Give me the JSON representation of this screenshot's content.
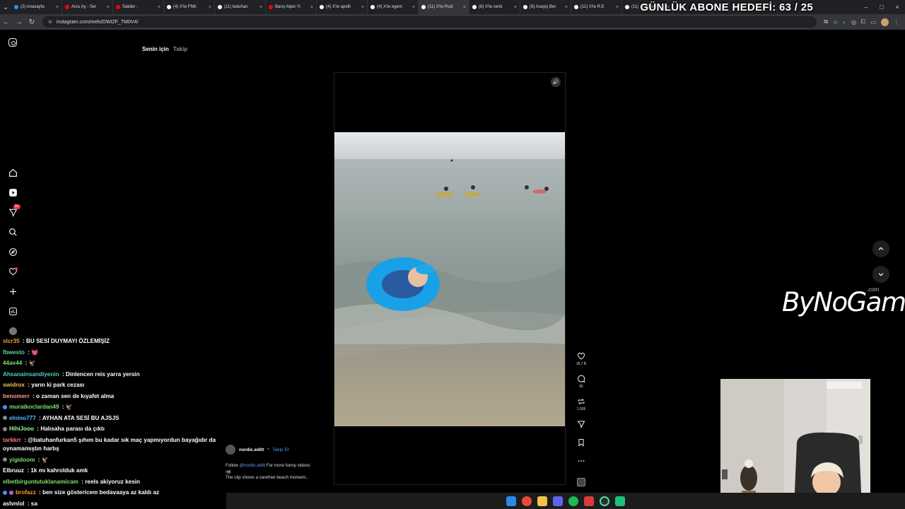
{
  "browser": {
    "tabs": [
      {
        "label": "(2) Anasayfa",
        "color": "#1d9bf0"
      },
      {
        "label": "Arzu Ay - Ser",
        "color": "#ff0000"
      },
      {
        "label": "Sakiler -",
        "color": "#ff0000"
      },
      {
        "label": "(4) X'te FNK",
        "color": "#ffffff"
      },
      {
        "label": "(11) batuhan",
        "color": "#ffffff"
      },
      {
        "label": "Barış Alper Yı",
        "color": "#ff0000"
      },
      {
        "label": "(4) X'te apolli",
        "color": "#ffffff"
      },
      {
        "label": "(4) X'te egem",
        "color": "#ffffff"
      },
      {
        "label": "(11) X'te Pust",
        "color": "#ffffff"
      },
      {
        "label": "(8) X'te cenk",
        "color": "#ffffff"
      },
      {
        "label": "(8) Asayiş Ber",
        "color": "#ffffff"
      },
      {
        "label": "(11) X'te R.E",
        "color": "#ffffff"
      },
      {
        "label": "(11) X'te Dah",
        "color": "#ffffff"
      }
    ],
    "tab_close": "×",
    "new_tab": "+",
    "url": "instagram.com/reels/DWIZF_TM0V4/",
    "win_min": "–",
    "win_max": "□",
    "win_close": "×"
  },
  "overlay": {
    "goal_text": "GÜNLÜK ABONE HEDEFİ: 63 / 25",
    "sponsor_logo": "ByNoGame",
    "sponsor_suffix": ".com"
  },
  "instagram": {
    "feed_tabs": {
      "for_you": "Senin için",
      "following": "Takip"
    },
    "nav_icons": [
      "home-icon",
      "reels-icon",
      "messages-icon",
      "search-icon",
      "explore-icon",
      "notifications-icon",
      "create-icon",
      "dashboard-icon",
      "profile-icon"
    ],
    "messages_badge": "9+",
    "post": {
      "author": "nordic.editt",
      "follow_label": "Takip Et",
      "caption_prefix": "Follow",
      "caption_mention": "@nordic.editt",
      "caption_suffix": "For more funny videos",
      "caption_line2": "The clip shows a carefree beach moment..."
    },
    "actions": {
      "likes": "18,7 B",
      "comments": "65",
      "reposts": "1.035"
    }
  },
  "chat": [
    {
      "user": "slcr35",
      "msg": "BU SESİ DUYMAYI ÖZLEMİŞİZ",
      "color": "#ff9a3c"
    },
    {
      "user": "fbwesto",
      "msg": "💓",
      "color": "#5dd39e"
    },
    {
      "user": "44av44",
      "msg": "🦅",
      "color": "#7ee06b"
    },
    {
      "user": "Ahsanainsandiyenin",
      "msg": "Dinlencen reis yarra yersin",
      "color": "#4ad2c0"
    },
    {
      "user": "swidrox",
      "msg": "yarın ki park cezası",
      "color": "#f0c04a"
    },
    {
      "user": "benomerr",
      "msg": "o zaman sen de kıyafet alma",
      "color": "#ff9a9a"
    },
    {
      "user": "muratkoclardan49",
      "msg": "🦅",
      "color": "#7ee06b"
    },
    {
      "user": "elnino777",
      "msg": "AYHAN ATA SESİ BU AJSJS",
      "color": "#4ac0ff"
    },
    {
      "user": "HihiJooo",
      "msg": "Halısaha parası da çıktı",
      "color": "#9aff9a"
    },
    {
      "user": "tarkkrr",
      "msg": "@batuhanfurkan5 şıhım bu kadar sık maç yapmıyordun bayağıdır da oynamamıştın harbş",
      "color": "#ff7a7a"
    },
    {
      "user": "yigidoom",
      "msg": "🦅",
      "color": "#7ee06b"
    },
    {
      "user": "Elbruuz",
      "msg": "1k mı kahrolduk amk",
      "color": "#ffffff"
    },
    {
      "user": "elbetbirguntutuklanamicam",
      "msg": "reels akiyoruz kesin",
      "color": "#7ee06b"
    },
    {
      "user": "brofazz",
      "msg": "ben size göstericem bedavaaya az kaldı az",
      "color": "#ff9a3c"
    },
    {
      "user": "aslvnlol",
      "msg": "sa",
      "color": "#ffffff"
    }
  ]
}
